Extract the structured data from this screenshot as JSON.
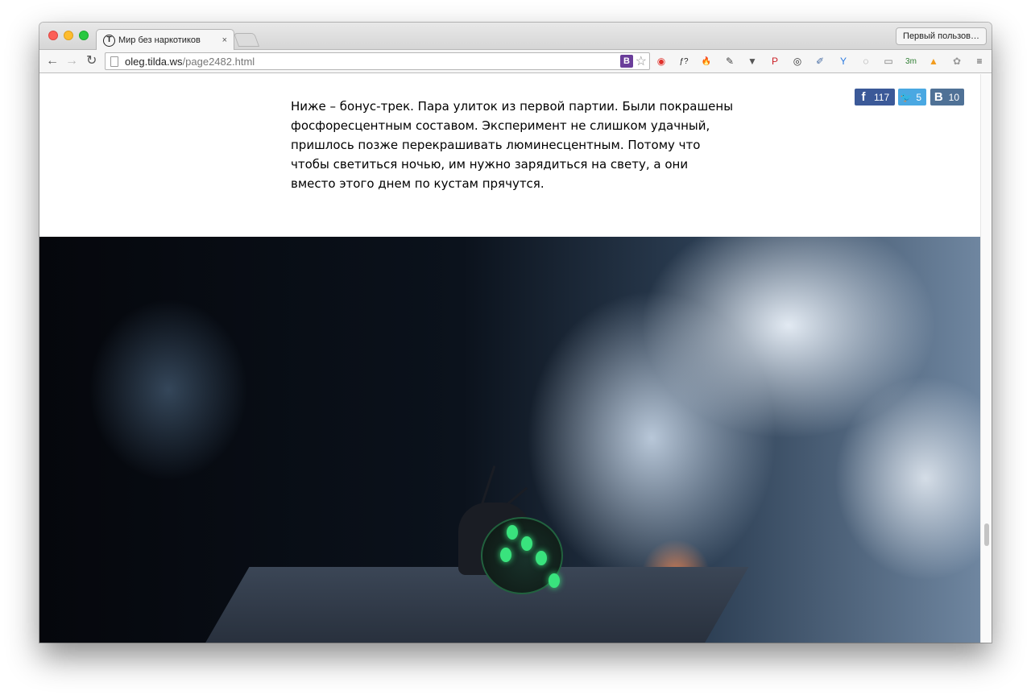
{
  "browser": {
    "tab_title": "Мир без наркотиков",
    "tab_favicon_letter": "T",
    "tab_close": "×",
    "profile_label": "Первый пользов…",
    "url_host": "oleg.tilda.ws",
    "url_path": "/page2482.html",
    "omnibox_ext_letter": "B",
    "star": "☆",
    "nav": {
      "back": "←",
      "forward": "→",
      "reload": "↻"
    }
  },
  "extensions": [
    {
      "name": "opera-o-icon",
      "glyph": "◉",
      "color": "#e0322c"
    },
    {
      "name": "f-question-icon",
      "glyph": "ƒ?",
      "color": "#222222"
    },
    {
      "name": "flame-icon",
      "glyph": "🔥",
      "color": "#f07a1a"
    },
    {
      "name": "evernote-icon",
      "glyph": "✎",
      "color": "#444444"
    },
    {
      "name": "pocket-icon",
      "glyph": "▼",
      "color": "#555555"
    },
    {
      "name": "pinterest-icon",
      "glyph": "P",
      "color": "#cb2027"
    },
    {
      "name": "lens-icon",
      "glyph": "◎",
      "color": "#333333"
    },
    {
      "name": "eyedropper-icon",
      "glyph": "✐",
      "color": "#4a6fa5"
    },
    {
      "name": "yandex-y-icon",
      "glyph": "Y",
      "color": "#2c7be0"
    },
    {
      "name": "refresh-circle-icon",
      "glyph": "◌",
      "color": "#777777"
    },
    {
      "name": "reader-icon",
      "glyph": "▭",
      "color": "#777777"
    },
    {
      "name": "gmail-3m-icon",
      "glyph": "3m",
      "color": "#2e7d32"
    },
    {
      "name": "chart-icon",
      "glyph": "▲",
      "color": "#f29c1f"
    },
    {
      "name": "paw-icon",
      "glyph": "✿",
      "color": "#999999"
    },
    {
      "name": "menu-icon",
      "glyph": "≡",
      "color": "#444444"
    }
  ],
  "article": {
    "paragraph": "Ниже – бонус-трек. Пара улиток из первой партии. Были покрашены фосфоресцентным составом. Эксперимент не слишком удачный, пришлось позже перекрашивать люминесцентным. Потому что чтобы светиться ночью, им нужно зарядиться на свету, а они вместо этого днем по кустам прячутся."
  },
  "share": {
    "facebook": {
      "icon": "f",
      "count": "117"
    },
    "twitter": {
      "icon": "🐦",
      "count": "5"
    },
    "vk": {
      "icon": "B",
      "count": "10"
    }
  },
  "colors": {
    "facebook": "#3b5998",
    "twitter": "#4aa8e2",
    "vk": "#4f7196",
    "snail_glow": "#39e37d"
  }
}
